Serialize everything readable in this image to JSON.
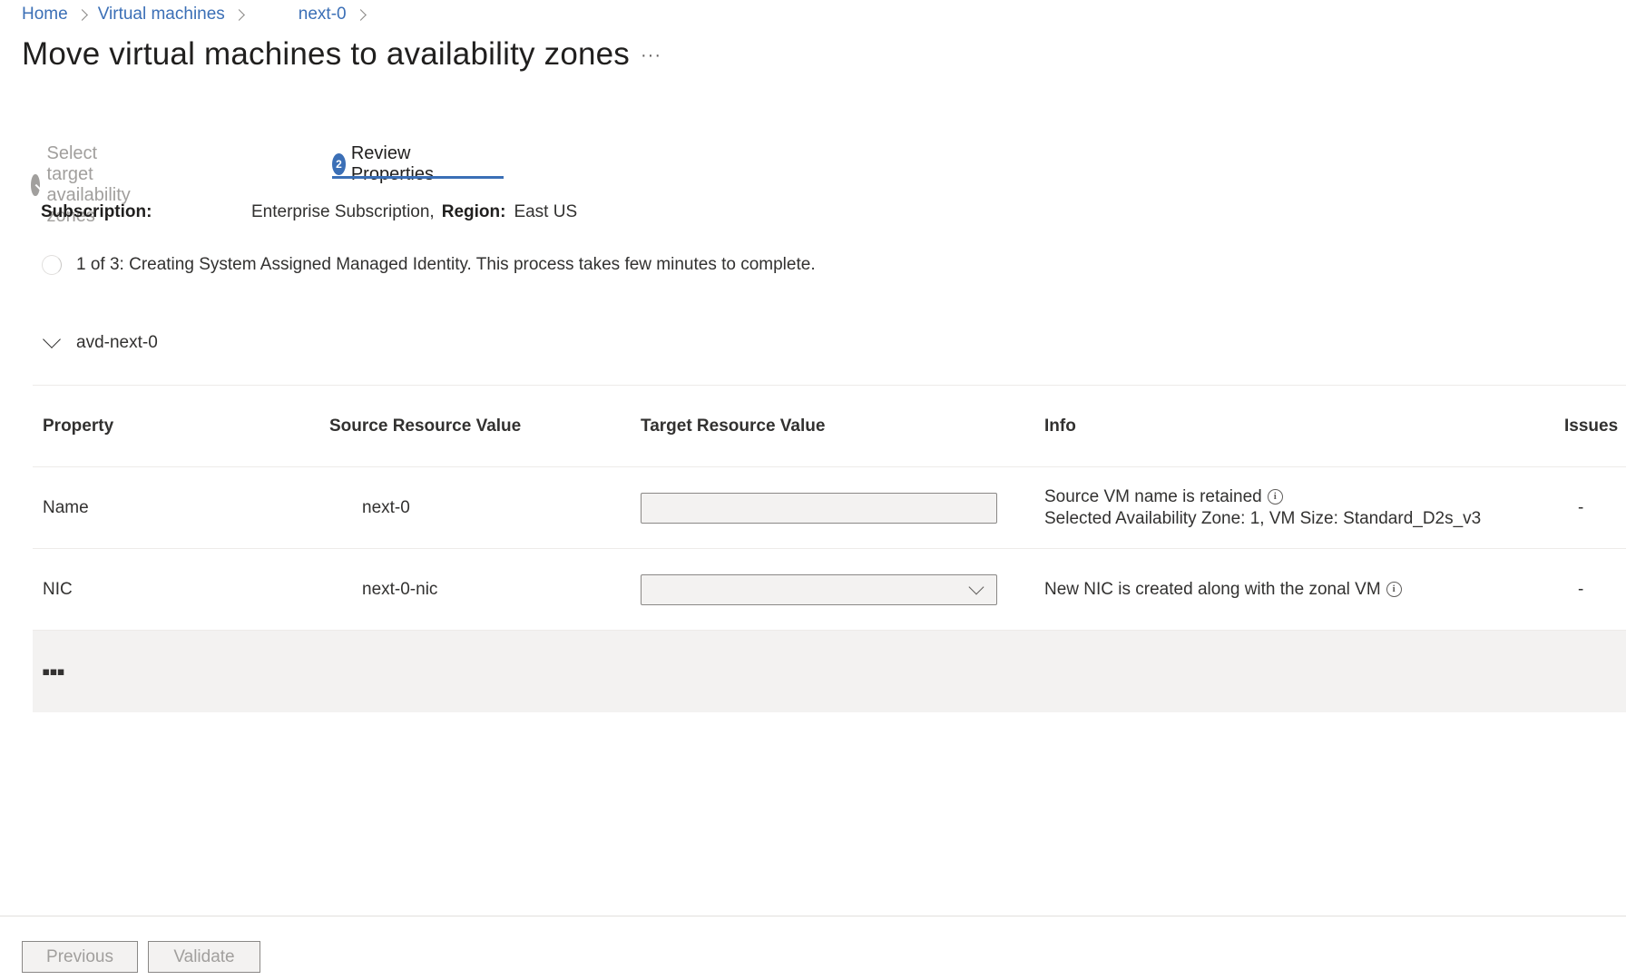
{
  "breadcrumb": {
    "items": [
      "Home",
      "Virtual machines",
      "next-0"
    ]
  },
  "page": {
    "title": "Move virtual machines to availability zones",
    "more": "···"
  },
  "steps": [
    {
      "label": "Select target availability zones",
      "state": "completed"
    },
    {
      "label": "Review Properties",
      "number": "2",
      "state": "active"
    }
  ],
  "subscription": {
    "label": "Subscription:",
    "value": "Enterprise Subscription,",
    "region_label": "Region:",
    "region_value": "East US"
  },
  "progress": {
    "text": "1 of 3: Creating System Assigned Managed Identity. This process takes few minutes to complete."
  },
  "group": {
    "name": "avd-next-0"
  },
  "table": {
    "headers": {
      "property": "Property",
      "source": "Source Resource Value",
      "target": "Target Resource Value",
      "info": "Info",
      "issues": "Issues"
    },
    "rows": [
      {
        "property": "Name",
        "source": "next-0",
        "target": "",
        "info_line1": "Source VM name is retained",
        "info_line2": "Selected Availability Zone: 1, VM Size: Standard_D2s_v3",
        "issues": "-"
      },
      {
        "property": "NIC",
        "source": "next-0-nic",
        "target": "",
        "info_line1": "New NIC is created along with the zonal VM",
        "issues": "-"
      }
    ],
    "load_more": "▪▪▪"
  },
  "footer": {
    "previous": "Previous",
    "validate": "Validate"
  },
  "colors": {
    "accent": "#3b6fb6",
    "disabled_text": "#a19f9d",
    "load_more_bg": "#f3f2f1"
  },
  "icons": {
    "completed_step": "check-circle-icon",
    "info": "info-icon",
    "collapse": "chevron-down-icon",
    "dropdown": "chevron-down-icon",
    "spinner": "spinner-icon"
  }
}
